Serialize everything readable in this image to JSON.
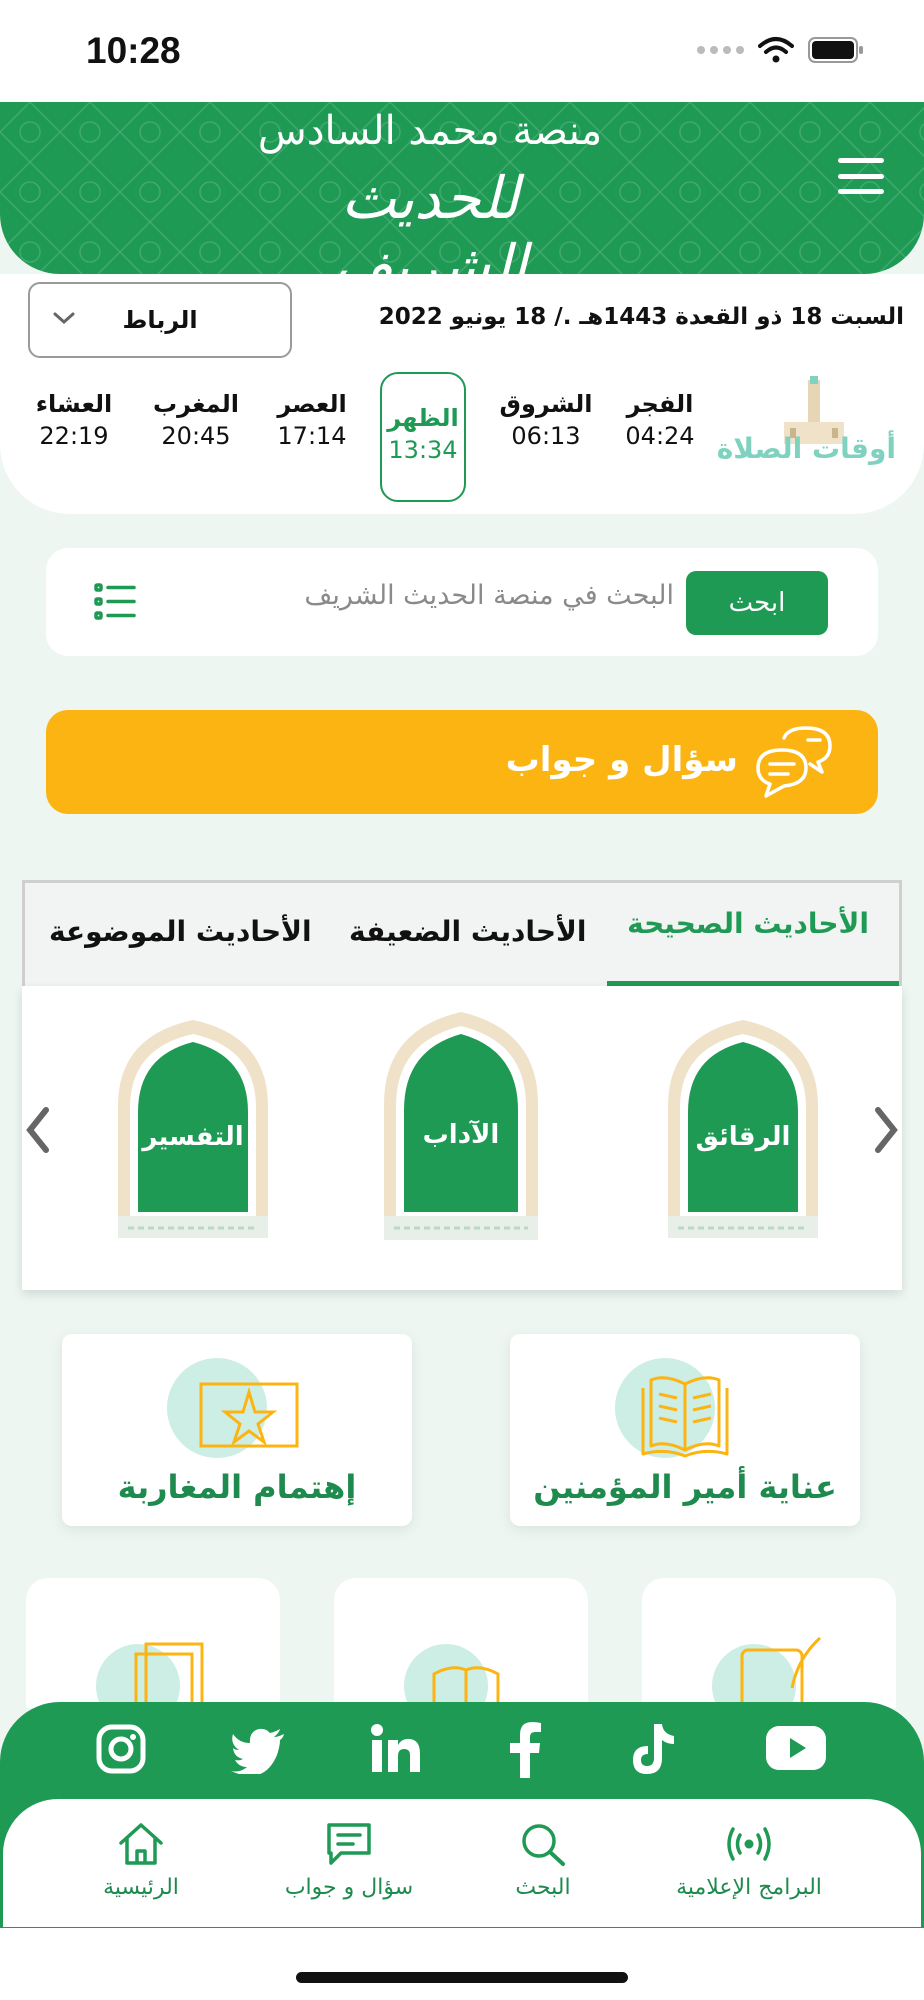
{
  "status": {
    "time": "10:28"
  },
  "header": {
    "subtitle": "منصة محمد السادس",
    "title": "للحديث الشريف"
  },
  "prayer": {
    "date": "السبت 18 ذو القعدة 1443هـ ./ 18 يونيو 2022",
    "city": "الرباط",
    "section_title": "أوقات الصلاة",
    "times": [
      {
        "name": "العشاء",
        "time": "22:19"
      },
      {
        "name": "المغرب",
        "time": "20:45"
      },
      {
        "name": "العصر",
        "time": "17:14"
      },
      {
        "name": "الظهر",
        "time": "13:34"
      },
      {
        "name": "الشروق",
        "time": "06:13"
      },
      {
        "name": "الفجر",
        "time": "04:24"
      }
    ],
    "active_prayer": "الظهر"
  },
  "search": {
    "placeholder": "البحث في منصة الحديث الشريف",
    "button_label": "ابحث"
  },
  "qa_banner": {
    "label": "سؤال و جواب"
  },
  "tabs": [
    {
      "label": "الأحاديث الموضوعة"
    },
    {
      "label": "الأحاديث الضعيفة"
    },
    {
      "label": "الأحاديث الصحيحة"
    }
  ],
  "carousel": {
    "items": [
      {
        "label": "التفسير"
      },
      {
        "label": "الآداب"
      },
      {
        "label": "الرقائق"
      }
    ]
  },
  "features": [
    {
      "label": "إهتمام المغاربة"
    },
    {
      "label": "عناية أمير المؤمنين"
    }
  ],
  "bottom_nav": [
    {
      "label": "الرئيسية",
      "icon": "home-icon"
    },
    {
      "label": "سؤال و جواب",
      "icon": "chat-icon"
    },
    {
      "label": "البحث",
      "icon": "search-icon"
    },
    {
      "label": "البرامج الإعلامية",
      "icon": "broadcast-icon"
    }
  ],
  "colors": {
    "primary": "#1f9a55",
    "accent": "#fcb413",
    "mint": "#7fd2c0"
  }
}
